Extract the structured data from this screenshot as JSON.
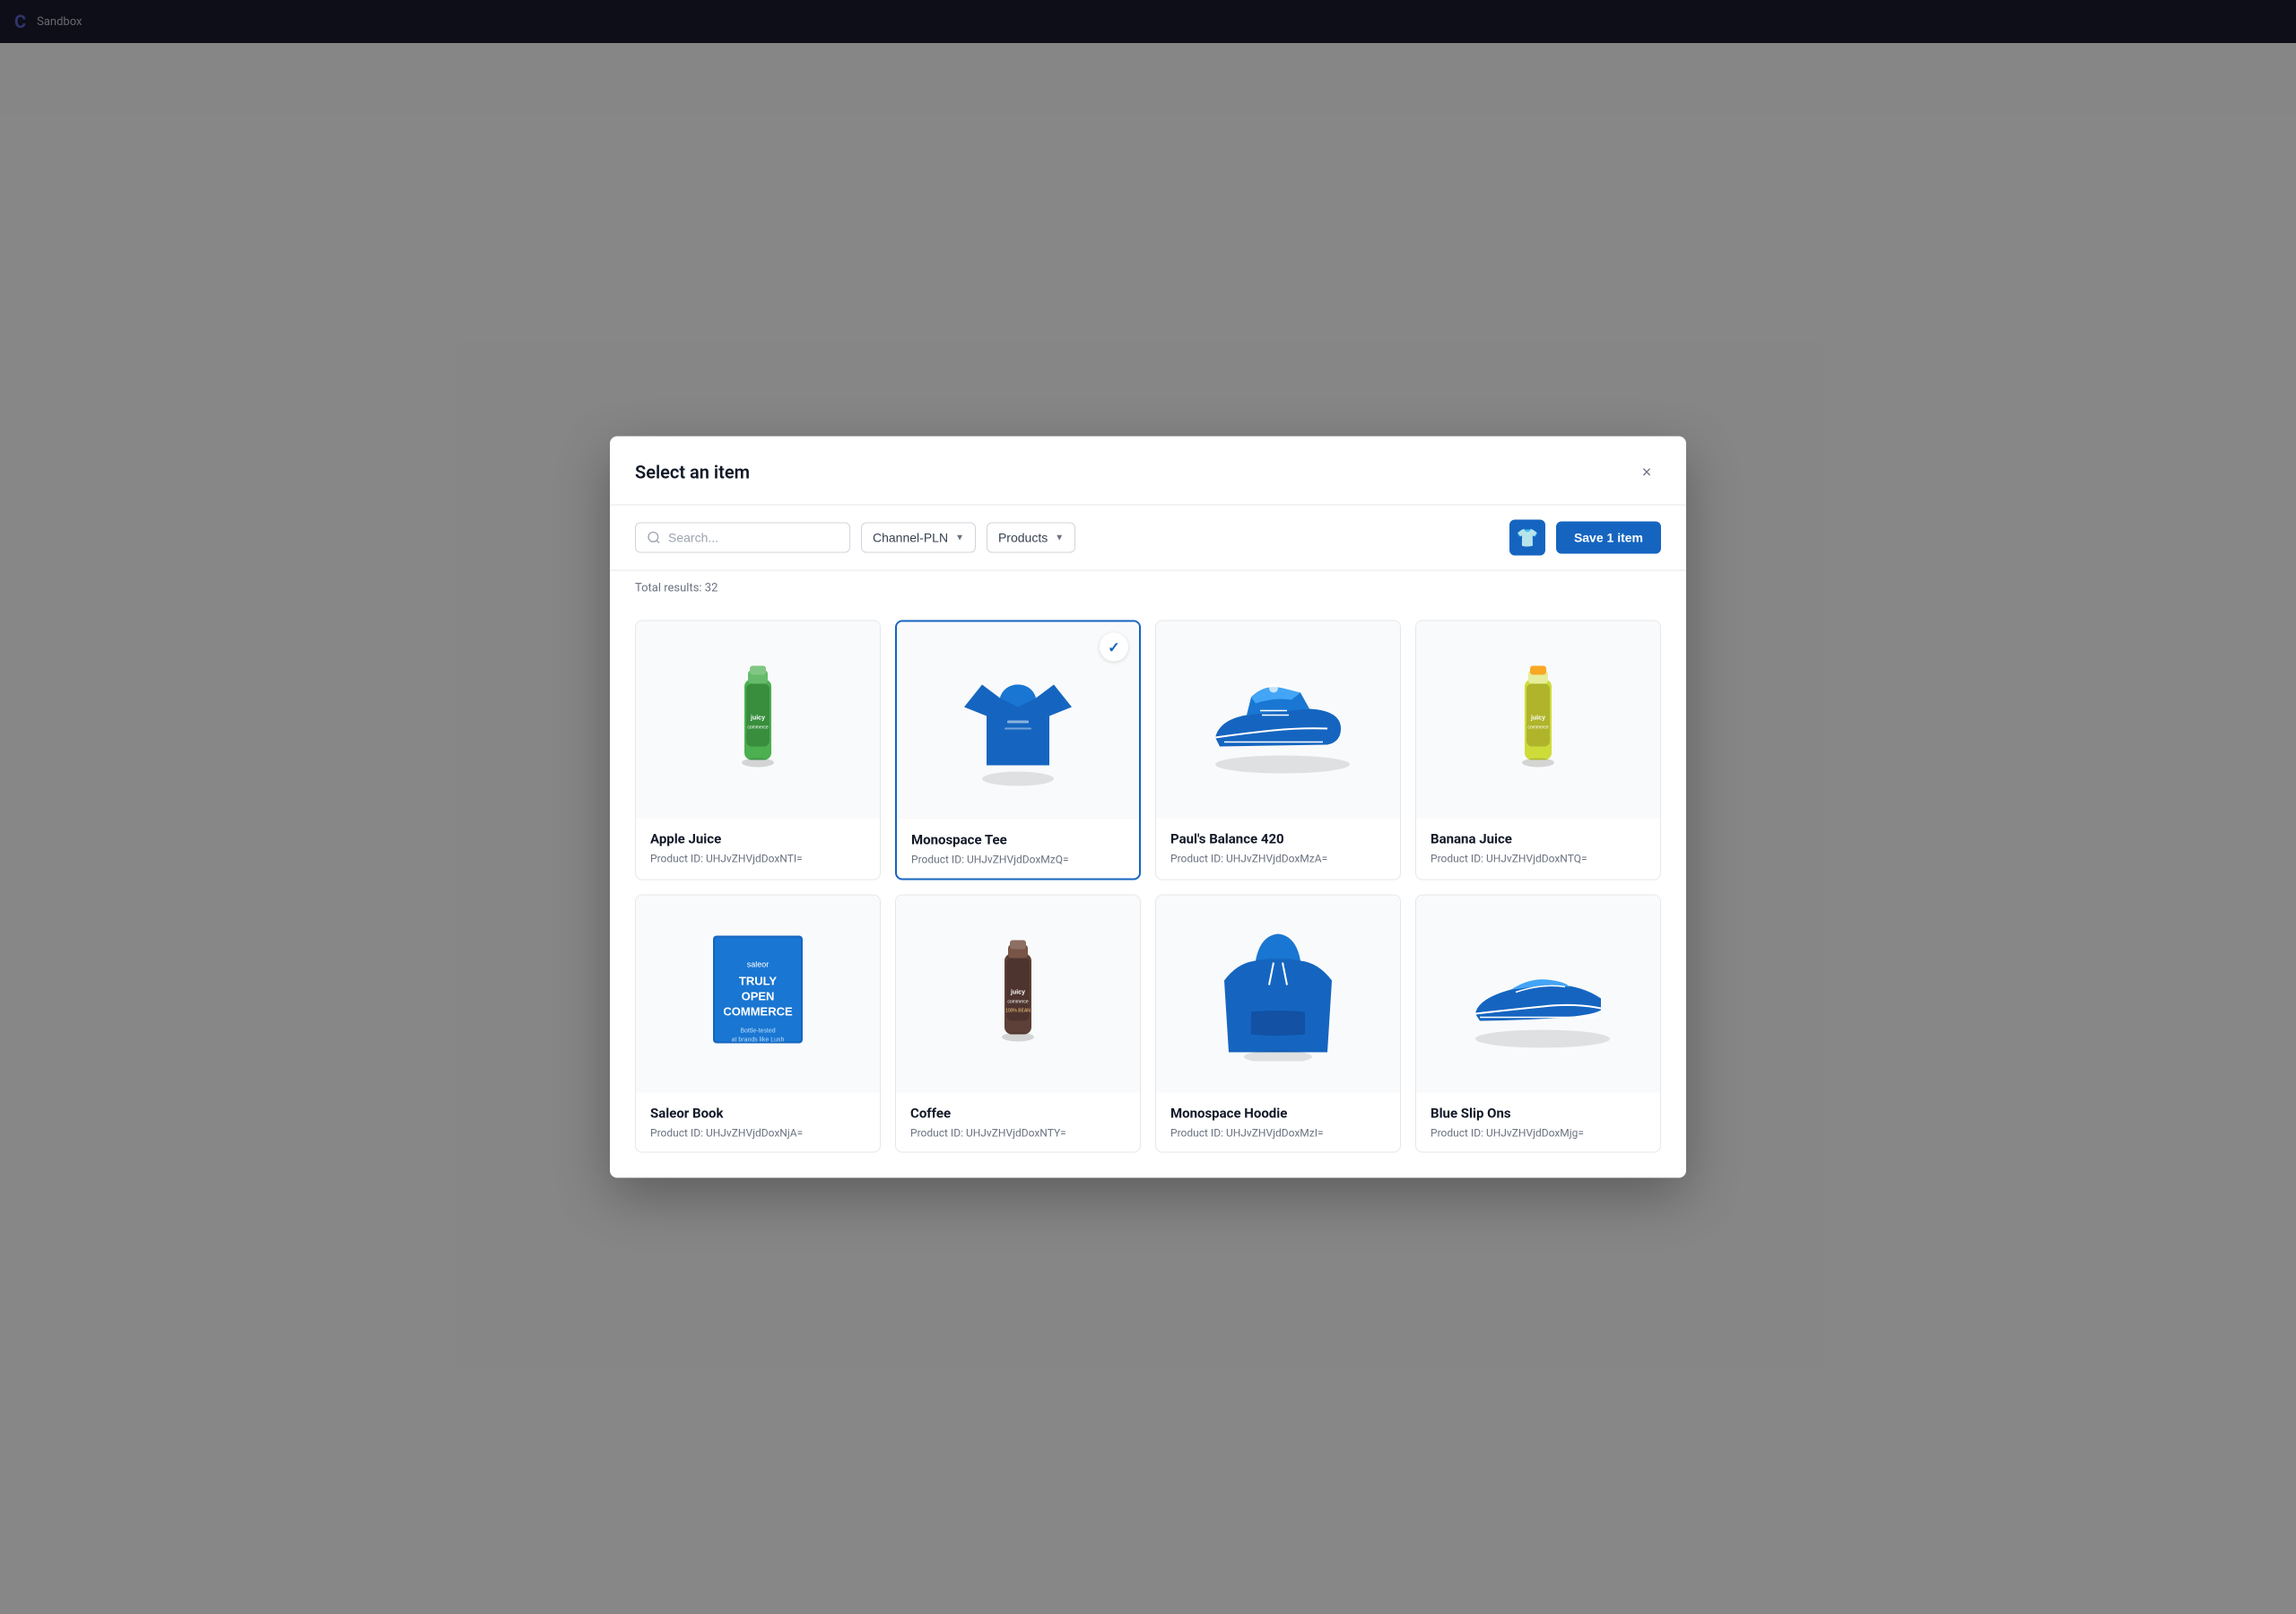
{
  "modal": {
    "title": "Select an item",
    "close_label": "×",
    "save_button_label": "Save 1 item",
    "total_results_label": "Total results: 32"
  },
  "toolbar": {
    "search_placeholder": "Search...",
    "channel_dropdown_label": "Channel-PLN",
    "type_dropdown_label": "Products"
  },
  "products": [
    {
      "id": "p1",
      "name": "Apple Juice",
      "product_id_label": "Product ID: UHJvZHVjdDoxNTI=",
      "selected": false,
      "type": "juice_green"
    },
    {
      "id": "p2",
      "name": "Monospace Tee",
      "product_id_label": "Product ID: UHJvZHVjdDoxMzQ=",
      "selected": true,
      "type": "tee_blue"
    },
    {
      "id": "p3",
      "name": "Paul's Balance 420",
      "product_id_label": "Product ID: UHJvZHVjdDoxMzA=",
      "selected": false,
      "type": "shoe_blue"
    },
    {
      "id": "p4",
      "name": "Banana Juice",
      "product_id_label": "Product ID: UHJvZHVjdDoxNTQ=",
      "selected": false,
      "type": "juice_yellow"
    },
    {
      "id": "p5",
      "name": "Saleor Book",
      "product_id_label": "Product ID: UHJvZHVjdDoxNjA=",
      "selected": false,
      "type": "saleor_book"
    },
    {
      "id": "p6",
      "name": "Coffee",
      "product_id_label": "Product ID: UHJvZHVjdDoxNTY=",
      "selected": false,
      "type": "coffee_bottle"
    },
    {
      "id": "p7",
      "name": "Monospace Hoodie",
      "product_id_label": "Product ID: UHJvZHVjdDoxMzI=",
      "selected": false,
      "type": "hoodie_blue"
    },
    {
      "id": "p8",
      "name": "Blue Slip Ons",
      "product_id_label": "Product ID: UHJvZHVjdDoxMjg=",
      "selected": false,
      "type": "slipon_blue"
    }
  ],
  "colors": {
    "primary": "#1565c0",
    "selected_border": "#1565c0",
    "check_color": "#1565c0"
  }
}
